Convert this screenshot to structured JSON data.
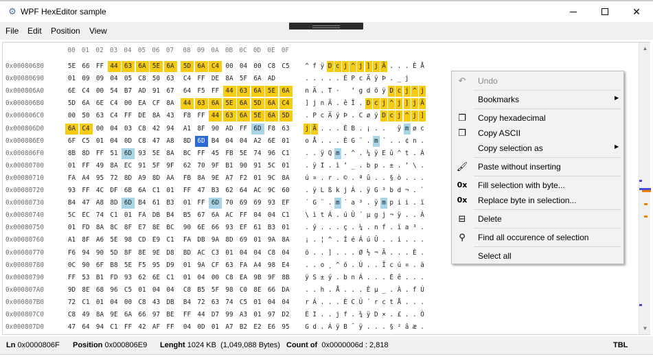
{
  "window": {
    "title": "WPF HexEditor sample",
    "icon": "gear-icon"
  },
  "menu": [
    "File",
    "Edit",
    "Position",
    "View"
  ],
  "columns": [
    "00",
    "01",
    "02",
    "03",
    "04",
    "05",
    "06",
    "07",
    "08",
    "09",
    "0A",
    "0B",
    "0C",
    "0D",
    "0E",
    "0F"
  ],
  "rows": [
    {
      "addr": "0x00080680",
      "bytes": [
        "5E",
        "66",
        "FF",
        "44",
        "63",
        "6A",
        "5E",
        "6A",
        "5D",
        "6A",
        "C4",
        "00",
        "04",
        "00",
        "C8",
        "C5"
      ],
      "ascii": [
        "^",
        "f",
        "ÿ",
        "D",
        "c",
        "j",
        "^",
        "j",
        "]",
        "j",
        "Ä",
        ".",
        ".",
        ".",
        "È",
        "Å"
      ]
    },
    {
      "addr": "0x00080690",
      "bytes": [
        "01",
        "09",
        "09",
        "04",
        "05",
        "C8",
        "50",
        "63",
        "C4",
        "FF",
        "DE",
        "8A",
        "5F",
        "6A",
        "AD",
        ""
      ],
      "ascii": [
        ".",
        ".",
        ".",
        ".",
        ".",
        "È",
        "P",
        "c",
        "Ä",
        "ÿ",
        "Þ",
        ".",
        "_",
        "j",
        "",
        ""
      ]
    },
    {
      "addr": "0x000806A0",
      "bytes": [
        "6E",
        "C4",
        "00",
        "54",
        "B7",
        "AD",
        "91",
        "67",
        "64",
        "F5",
        "FF",
        "44",
        "63",
        "6A",
        "5E",
        "6A"
      ],
      "ascii": [
        "n",
        "Ä",
        ".",
        "T",
        "·",
        "",
        "‘",
        "g",
        "d",
        "õ",
        "ÿ",
        "D",
        "c",
        "j",
        "^",
        "j"
      ]
    },
    {
      "addr": "0x000806B0",
      "bytes": [
        "5D",
        "6A",
        "6E",
        "C4",
        "00",
        "EA",
        "CF",
        "8A",
        "44",
        "63",
        "6A",
        "5E",
        "6A",
        "5D",
        "6A",
        "C4"
      ],
      "ascii": [
        "]",
        "j",
        "n",
        "Ä",
        ".",
        "ê",
        "Ï",
        ".",
        "D",
        "c",
        "j",
        "^",
        "j",
        "]",
        "j",
        "Ä"
      ]
    },
    {
      "addr": "0x000806C0",
      "bytes": [
        "00",
        "50",
        "63",
        "C4",
        "FF",
        "DE",
        "8A",
        "43",
        "F8",
        "FF",
        "44",
        "63",
        "6A",
        "5E",
        "6A",
        "5D"
      ],
      "ascii": [
        ".",
        "P",
        "c",
        "Ä",
        "ÿ",
        "Þ",
        ".",
        "C",
        "ø",
        "ÿ",
        "D",
        "c",
        "j",
        "^",
        "j",
        "]"
      ]
    },
    {
      "addr": "0x000806D0",
      "bytes": [
        "6A",
        "C4",
        "00",
        "04",
        "03",
        "C8",
        "42",
        "94",
        "A1",
        "8F",
        "90",
        "AD",
        "FF",
        "6D",
        "F8",
        "63"
      ],
      "ascii": [
        "j",
        "Ä",
        ".",
        ".",
        ".",
        "È",
        "B",
        ".",
        "¡",
        ".",
        ".",
        "",
        "ÿ",
        "m",
        "ø",
        "c"
      ]
    },
    {
      "addr": "0x000806E0",
      "bytes": [
        "6F",
        "C5",
        "01",
        "04",
        "0D",
        "C8",
        "47",
        "A8",
        "8D",
        "6D",
        "B4",
        "04",
        "04",
        "A2",
        "6E",
        "01"
      ],
      "ascii": [
        "o",
        "Å",
        ".",
        ".",
        ".",
        "È",
        "G",
        "¨",
        ".",
        "m",
        "´",
        ".",
        ".",
        "¢",
        "n",
        "."
      ]
    },
    {
      "addr": "0x000806F0",
      "bytes": [
        "8B",
        "8D",
        "FF",
        "51",
        "6D",
        "93",
        "5E",
        "8A",
        "BC",
        "FF",
        "45",
        "FB",
        "5E",
        "74",
        "96",
        "C1"
      ],
      "ascii": [
        ".",
        ".",
        "ÿ",
        "Q",
        "m",
        ".",
        "^",
        ".",
        "¼",
        "ÿ",
        "E",
        "û",
        "^",
        "t",
        ".",
        "Á"
      ]
    },
    {
      "addr": "0x00080700",
      "bytes": [
        "01",
        "FF",
        "49",
        "8A",
        "EC",
        "91",
        "5F",
        "9F",
        "62",
        "70",
        "9F",
        "B1",
        "90",
        "91",
        "5C",
        "01"
      ],
      "ascii": [
        ".",
        "ÿ",
        "I",
        ".",
        "ì",
        "‘",
        "_",
        ".",
        "b",
        "p",
        ".",
        "±",
        ".",
        "‘",
        "\\",
        "."
      ]
    },
    {
      "addr": "0x00080710",
      "bytes": [
        "FA",
        "A4",
        "95",
        "72",
        "8D",
        "A9",
        "8D",
        "AA",
        "FB",
        "8A",
        "9E",
        "A7",
        "F2",
        "01",
        "9C",
        "8A"
      ],
      "ascii": [
        "ú",
        "¤",
        ".",
        "r",
        ".",
        "©",
        ".",
        "ª",
        "û",
        ".",
        ".",
        "§",
        "ò",
        ".",
        ".",
        "."
      ]
    },
    {
      "addr": "0x00080720",
      "bytes": [
        "93",
        "FF",
        "4C",
        "DF",
        "6B",
        "6A",
        "C1",
        "01",
        "FF",
        "47",
        "B3",
        "62",
        "64",
        "AC",
        "9C",
        "60"
      ],
      "ascii": [
        ".",
        "ÿ",
        "L",
        "ß",
        "k",
        "j",
        "Á",
        ".",
        "ÿ",
        "G",
        "³",
        "b",
        "d",
        "¬",
        ".",
        "`"
      ]
    },
    {
      "addr": "0x00080730",
      "bytes": [
        "B4",
        "47",
        "A8",
        "8D",
        "6D",
        "B4",
        "61",
        "B3",
        "01",
        "FF",
        "6D",
        "70",
        "69",
        "69",
        "93",
        "EF"
      ],
      "ascii": [
        "´",
        "G",
        "¨",
        ".",
        "m",
        "´",
        "a",
        "³",
        ".",
        "ÿ",
        "m",
        "p",
        "i",
        "i",
        ".",
        "ï"
      ]
    },
    {
      "addr": "0x00080740",
      "bytes": [
        "5C",
        "EC",
        "74",
        "C1",
        "01",
        "FA",
        "DB",
        "B4",
        "B5",
        "67",
        "6A",
        "AC",
        "FF",
        "04",
        "04",
        "C1"
      ],
      "ascii": [
        "\\",
        "ì",
        "t",
        "Á",
        ".",
        "ú",
        "Û",
        "´",
        "µ",
        "g",
        "j",
        "¬",
        "ÿ",
        ".",
        ".",
        "Á"
      ]
    },
    {
      "addr": "0x00080750",
      "bytes": [
        "01",
        "FD",
        "8A",
        "8C",
        "8F",
        "E7",
        "8E",
        "BC",
        "90",
        "6E",
        "66",
        "93",
        "EF",
        "61",
        "B3",
        "01"
      ],
      "ascii": [
        ".",
        "ý",
        ".",
        ".",
        ".",
        "ç",
        ".",
        "¼",
        ".",
        "n",
        "f",
        ".",
        "ï",
        "a",
        "³",
        "."
      ]
    },
    {
      "addr": "0x00080760",
      "bytes": [
        "A1",
        "8F",
        "A6",
        "5E",
        "98",
        "CD",
        "E9",
        "C1",
        "FA",
        "DB",
        "9A",
        "8D",
        "69",
        "01",
        "9A",
        "8A"
      ],
      "ascii": [
        "¡",
        ".",
        "¦",
        "^",
        ".",
        "Í",
        "é",
        "Á",
        "ú",
        "Û",
        ".",
        ".",
        "i",
        ".",
        ".",
        "."
      ]
    },
    {
      "addr": "0x00080770",
      "bytes": [
        "F6",
        "94",
        "90",
        "5D",
        "8F",
        "8E",
        "9E",
        "D8",
        "BD",
        "AC",
        "C3",
        "01",
        "04",
        "04",
        "C8",
        "04"
      ],
      "ascii": [
        "ö",
        ".",
        ".",
        "]",
        ".",
        ".",
        ".",
        "Ø",
        "½",
        "¬",
        "Ã",
        ".",
        ".",
        ".",
        "È",
        "."
      ]
    },
    {
      "addr": "0x00080780",
      "bytes": [
        "0C",
        "90",
        "6F",
        "B8",
        "5E",
        "F5",
        "95",
        "D9",
        "01",
        "9A",
        "CF",
        "63",
        "FA",
        "A4",
        "98",
        "E4"
      ],
      "ascii": [
        ".",
        ".",
        "o",
        "¸",
        "^",
        "õ",
        ".",
        "Ù",
        ".",
        ".",
        "Ï",
        "c",
        "ú",
        "¤",
        ".",
        "ä"
      ]
    },
    {
      "addr": "0x00080790",
      "bytes": [
        "FF",
        "53",
        "B1",
        "FD",
        "93",
        "62",
        "6E",
        "C1",
        "01",
        "04",
        "00",
        "C8",
        "EA",
        "9B",
        "9F",
        "8B"
      ],
      "ascii": [
        "ÿ",
        "S",
        "±",
        "ý",
        ".",
        "b",
        "n",
        "Á",
        ".",
        ".",
        ".",
        "È",
        "ê",
        ".",
        ".",
        "."
      ]
    },
    {
      "addr": "0x000807A0",
      "bytes": [
        "9D",
        "8E",
        "68",
        "96",
        "C5",
        "01",
        "04",
        "04",
        "C8",
        "B5",
        "5F",
        "98",
        "C0",
        "8E",
        "66",
        "DA"
      ],
      "ascii": [
        ".",
        ".",
        "h",
        ".",
        "Å",
        ".",
        ".",
        ".",
        "È",
        "µ",
        "_",
        ".",
        "À",
        ".",
        "f",
        "Ú"
      ]
    },
    {
      "addr": "0x000807B0",
      "bytes": [
        "72",
        "C1",
        "01",
        "04",
        "00",
        "C8",
        "43",
        "DB",
        "B4",
        "72",
        "63",
        "74",
        "C5",
        "01",
        "04",
        "04"
      ],
      "ascii": [
        "r",
        "Á",
        ".",
        ".",
        ".",
        "È",
        "C",
        "Û",
        "´",
        "r",
        "c",
        "t",
        "Å",
        ".",
        ".",
        "."
      ]
    },
    {
      "addr": "0x000807C0",
      "bytes": [
        "C8",
        "49",
        "8A",
        "9E",
        "6A",
        "66",
        "97",
        "BE",
        "FF",
        "44",
        "D7",
        "99",
        "A3",
        "01",
        "97",
        "D2"
      ],
      "ascii": [
        "È",
        "I",
        ".",
        ".",
        "j",
        "f",
        ".",
        "¾",
        "ÿ",
        "D",
        "×",
        ".",
        "£",
        ".",
        ".",
        "Ò"
      ]
    },
    {
      "addr": "0x000807D0",
      "bytes": [
        "47",
        "64",
        "94",
        "C1",
        "FF",
        "42",
        "AF",
        "FF",
        "04",
        "0D",
        "01",
        "A7",
        "B2",
        "E2",
        "E6",
        "95"
      ],
      "ascii": [
        "G",
        "d",
        ".",
        "Á",
        "ÿ",
        "B",
        "¯",
        "ÿ",
        ".",
        ".",
        ".",
        "§",
        "²",
        "â",
        "æ",
        "."
      ]
    }
  ],
  "highlights": {
    "yellow": [
      [
        0,
        3
      ],
      [
        0,
        4
      ],
      [
        0,
        5
      ],
      [
        0,
        6
      ],
      [
        0,
        7
      ],
      [
        0,
        8
      ],
      [
        0,
        9
      ],
      [
        0,
        10
      ],
      [
        2,
        11
      ],
      [
        2,
        12
      ],
      [
        2,
        13
      ],
      [
        2,
        14
      ],
      [
        2,
        15
      ],
      [
        3,
        8
      ],
      [
        3,
        9
      ],
      [
        3,
        10
      ],
      [
        3,
        11
      ],
      [
        3,
        12
      ],
      [
        3,
        13
      ],
      [
        3,
        14
      ],
      [
        3,
        15
      ],
      [
        4,
        10
      ],
      [
        4,
        11
      ],
      [
        4,
        12
      ],
      [
        4,
        13
      ],
      [
        4,
        14
      ],
      [
        4,
        15
      ],
      [
        5,
        0
      ],
      [
        5,
        1
      ]
    ],
    "blue": [
      [
        5,
        13
      ],
      [
        6,
        9
      ],
      [
        7,
        4
      ],
      [
        11,
        4
      ],
      [
        11,
        10
      ]
    ],
    "selected": [
      [
        6,
        9
      ]
    ]
  },
  "context_menu": [
    {
      "label": "Undo",
      "icon": "undo-icon",
      "glyph": "↶",
      "disabled": true
    },
    {
      "sep": true
    },
    {
      "label": "Bookmarks",
      "submenu": true
    },
    {
      "sep": true
    },
    {
      "label": "Copy hexadecimal",
      "icon": "copy-icon",
      "glyph": "❐"
    },
    {
      "label": "Copy ASCII",
      "icon": "copy-icon",
      "glyph": "❐"
    },
    {
      "label": "Copy selection as",
      "submenu": true
    },
    {
      "sep": true
    },
    {
      "label": "Paste without inserting",
      "icon": "paste-brush-icon",
      "glyph": "🖌"
    },
    {
      "sep": true
    },
    {
      "label": "Fill selection with byte...",
      "icon": "hex-0x-icon",
      "glyph": "0x",
      "text_icon": true
    },
    {
      "label": "Replace byte in selection...",
      "icon": "hex-0x-icon",
      "glyph": "0x",
      "text_icon": true
    },
    {
      "sep": true
    },
    {
      "label": "Delete",
      "icon": "delete-icon",
      "glyph": "⊟"
    },
    {
      "sep": true
    },
    {
      "label": "Find all occurence of selection",
      "icon": "find-icon",
      "glyph": "⚲"
    },
    {
      "sep": true
    },
    {
      "label": "Select all"
    }
  ],
  "status": {
    "ln_label": "Ln",
    "ln_value": "0x0000806F",
    "position_label": "Position",
    "position_value": "0x000806E9",
    "length_label": "Lenght",
    "length_value": "1024 KB",
    "length_bytes": "(1,049,088 Bytes)",
    "count_label": "Count of",
    "count_value": "0x0000006d : 2,818",
    "tbl": "TBL"
  },
  "colors": {
    "highlight_yellow": "#f5cb14",
    "highlight_blue": "#a8d4e8",
    "selection_blue": "#2a6bd4"
  }
}
